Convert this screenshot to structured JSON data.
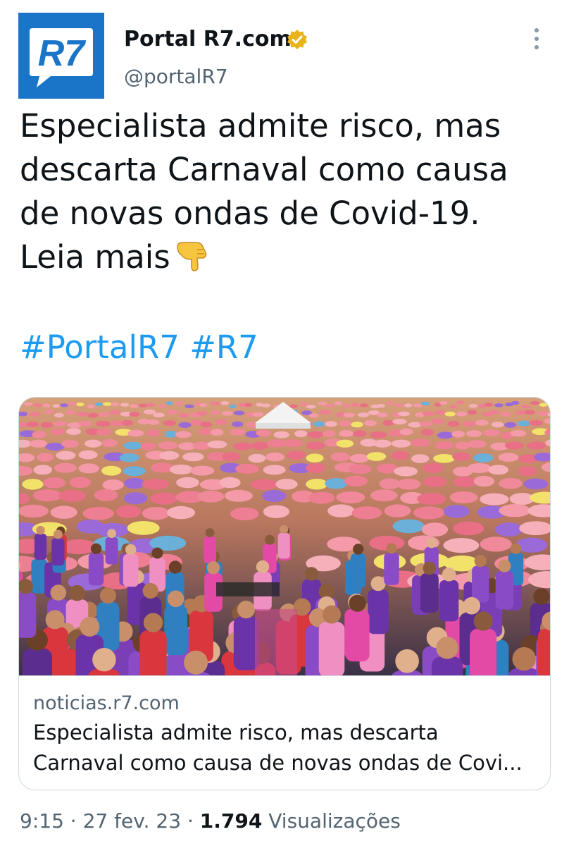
{
  "author": {
    "name": "Portal R7.com",
    "handle": "@portalR7",
    "avatar_text": "R7",
    "verified_icon": "verified-badge-icon",
    "brand_color": "#1a74c7"
  },
  "tweet": {
    "text": "Especialista admite risco, mas descarta Carnaval como causa de novas ondas de Covid-19. Leia mais",
    "emoji_icon": "backhand-index-pointing-down-icon",
    "hashtags": [
      "#PortalR7",
      "#R7"
    ]
  },
  "card": {
    "domain": "noticias.r7.com",
    "title_line1": "Especialista admite risco, mas descarta",
    "title_line2": "Carnaval como causa de novas ondas de Covi..."
  },
  "meta": {
    "time": "9:15",
    "separator": "·",
    "date": "27 fev. 23",
    "views_count": "1.794",
    "views_label": "Visualizações"
  },
  "colors": {
    "link": "#1d9bf0",
    "secondary_text": "#536471",
    "primary_text": "#0f1419",
    "verified_gold": "#e8b31b"
  }
}
